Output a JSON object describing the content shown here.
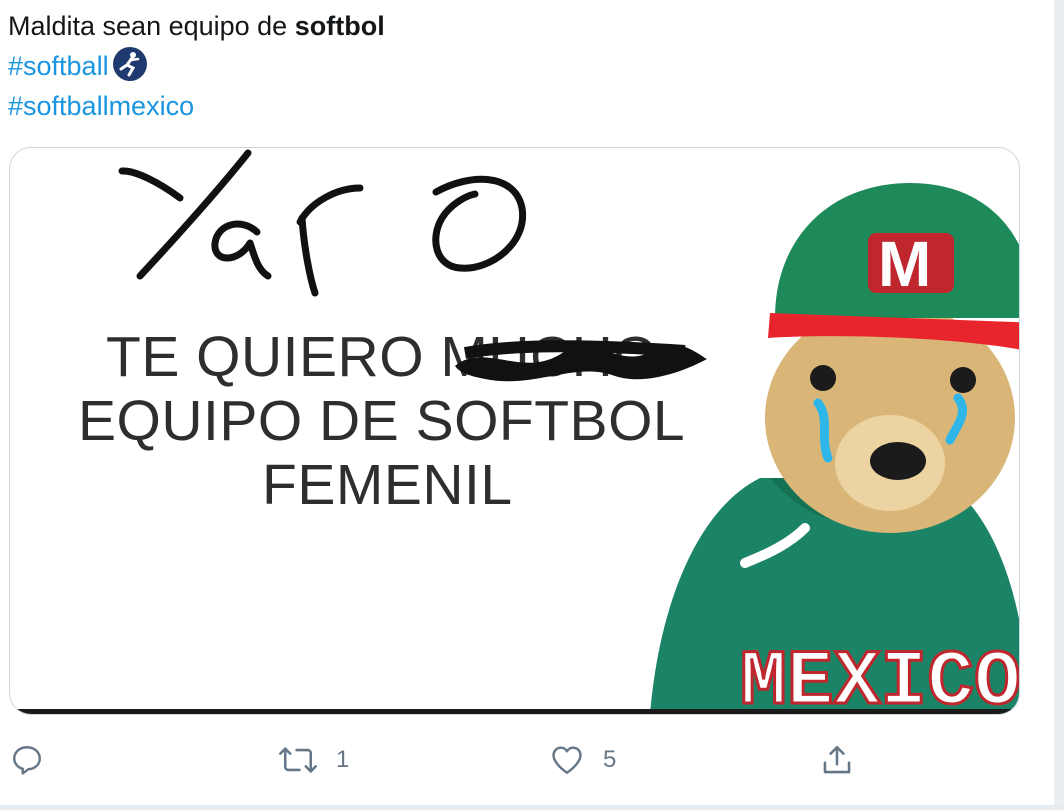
{
  "tweet": {
    "text_prefix": "Maldita sean equipo de ",
    "text_bold": "softbol",
    "hashtags": [
      "#softball",
      "#softballmexico"
    ],
    "emoji_icon": "softball-player-icon"
  },
  "media": {
    "handwritten": "Ya no",
    "lines": [
      "TE QUIERO MUCHO",
      "EQUIPO DE SOFTBOL",
      "FEMENIL"
    ],
    "cap_letter": "M",
    "jersey_text": "MEXICO",
    "colors": {
      "cap_green": "#1e8a5a",
      "cap_band": "#e8252d",
      "jersey": "#1b8466",
      "dog_fur": "#d9b678",
      "tears": "#2fb6e8"
    }
  },
  "actions": {
    "reply_icon": "reply-icon",
    "retweet_icon": "retweet-icon",
    "retweet_count": "1",
    "like_icon": "heart-icon",
    "like_count": "5",
    "share_icon": "share-icon"
  }
}
